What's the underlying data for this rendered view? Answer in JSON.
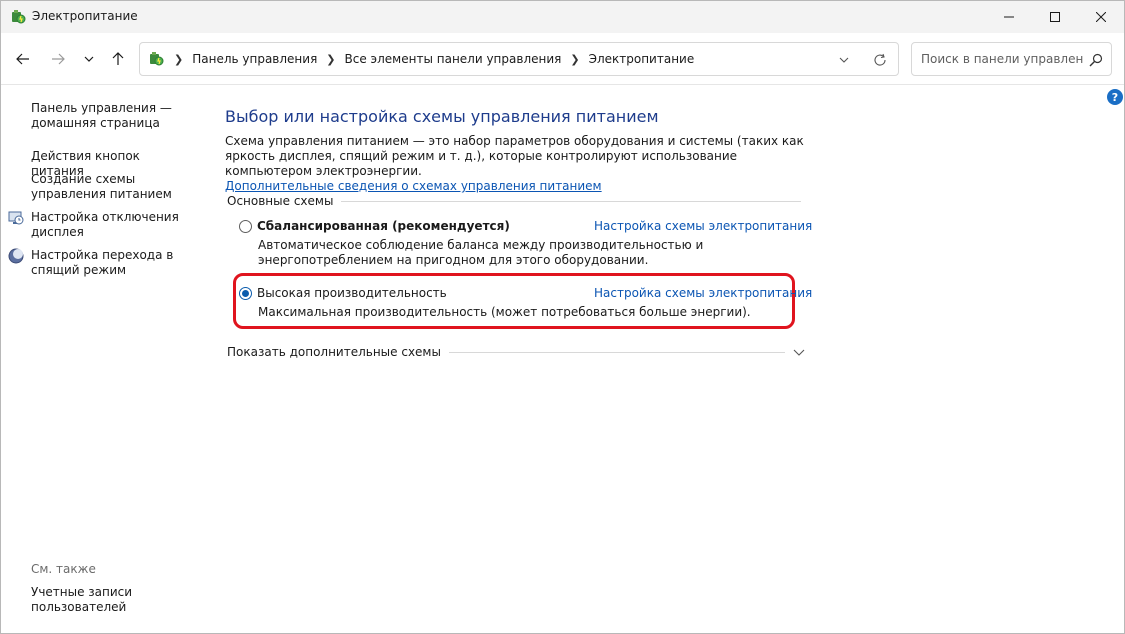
{
  "window": {
    "title": "Электропитание"
  },
  "nav": {
    "breadcrumbs": [
      "Панель управления",
      "Все элементы панели управления",
      "Электропитание"
    ],
    "search_placeholder": "Поиск в панели управления"
  },
  "sidebar": {
    "links": [
      {
        "label": "Панель управления — домашняя страница",
        "icon": ""
      },
      {
        "label": "Действия кнопок питания",
        "icon": ""
      },
      {
        "label": "Создание схемы управления питанием",
        "icon": ""
      },
      {
        "label": "Настройка отключения дисплея",
        "icon": "display-clock-icon"
      },
      {
        "label": "Настройка перехода в спящий режим",
        "icon": "moon-icon"
      }
    ],
    "see_also_heading": "См. также",
    "see_also": [
      {
        "label": "Учетные записи пользователей"
      }
    ]
  },
  "main": {
    "title": "Выбор или настройка схемы управления питанием",
    "description": "Схема управления питанием — это набор параметров оборудования и системы (таких как яркость дисплея, спящий режим и т. д.), которые контролируют использование компьютером электроэнергии.",
    "more_link": "Дополнительные сведения о схемах управления питанием",
    "section_heading": "Основные схемы",
    "plans": [
      {
        "name": "Сбалансированная (рекомендуется)",
        "selected": false,
        "link": "Настройка схемы электропитания",
        "description": "Автоматическое соблюдение баланса между производительностью и энергопотреблением на пригодном для этого оборудовании."
      },
      {
        "name": "Высокая производительность",
        "selected": true,
        "link": "Настройка схемы электропитания",
        "description": "Максимальная производительность (может потребоваться больше энергии)."
      }
    ],
    "show_more": "Показать дополнительные схемы"
  },
  "colors": {
    "accent": "#0b55b3",
    "title": "#1e3c8c",
    "highlight": "#e0141e"
  },
  "help": "?"
}
